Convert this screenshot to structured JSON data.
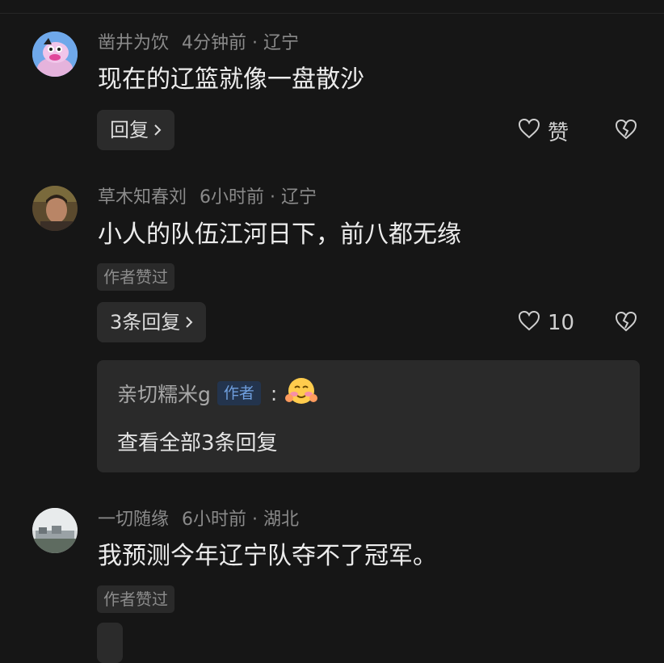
{
  "comments": [
    {
      "username": "凿井为饮",
      "time": "4分钟前",
      "location": "辽宁",
      "text": "现在的辽篮就像一盘散沙",
      "reply_label": "回复",
      "like_label": "赞"
    },
    {
      "username": "草木知春刘",
      "time": "6小时前",
      "location": "辽宁",
      "text": "小人的队伍江河日下，前八都无缘",
      "badge": "作者赞过",
      "reply_label": "3条回复",
      "like_count": "10",
      "sub_reply": {
        "author": "亲切糯米g",
        "author_tag": "作者",
        "colon": ":",
        "view_all": "查看全部3条回复"
      }
    },
    {
      "username": "一切随缘",
      "time": "6小时前",
      "location": "湖北",
      "text": "我预测今年辽宁队夺不了冠军。",
      "badge": "作者赞过"
    }
  ],
  "separator": "·",
  "icons": {
    "like": "heart-icon",
    "dislike": "broken-heart-icon",
    "chevron": "chevron-right-icon",
    "emoji": "blush-emoji-icon"
  },
  "colors": {
    "background": "#161616",
    "author_tag_bg": "#23344d",
    "author_tag_text": "#6f9fde"
  }
}
